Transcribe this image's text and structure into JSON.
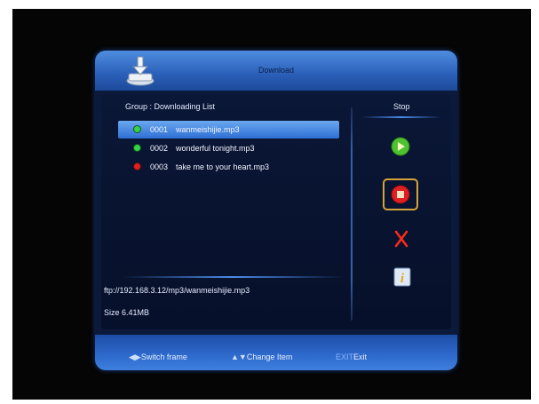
{
  "window": {
    "title": "Download"
  },
  "list": {
    "group_label": "Group : Downloading List",
    "items": [
      {
        "number": "0001",
        "name": "wanmeishijie.mp3",
        "state_color": "#36d24a",
        "selected": true
      },
      {
        "number": "0002",
        "name": "wonderful tonight.mp3",
        "state_color": "#36d24a",
        "selected": false
      },
      {
        "number": "0003",
        "name": "take me to your heart.mp3",
        "state_color": "#e02020",
        "selected": false
      }
    ]
  },
  "side_panel": {
    "stop_label": "Stop",
    "buttons": [
      {
        "icon": "play-icon",
        "color": "#4ec230"
      },
      {
        "icon": "stop-icon",
        "color": "#e02020",
        "focused": true
      },
      {
        "icon": "delete-icon",
        "color": "#ff2a1a"
      },
      {
        "icon": "info-icon",
        "color": "#f0c020"
      }
    ]
  },
  "details": {
    "url": "ftp://192.168.3.12/mp3/wanmeishijie.mp3",
    "size": "Size 6.41MB"
  },
  "footer": {
    "switch_frame": "Switch frame",
    "change_item": "Change Item",
    "exit_key": "EXIT",
    "exit_label": "Exit"
  },
  "colors": {
    "accent": "#2f6fd4",
    "window_bg": "#0b1a3a"
  }
}
